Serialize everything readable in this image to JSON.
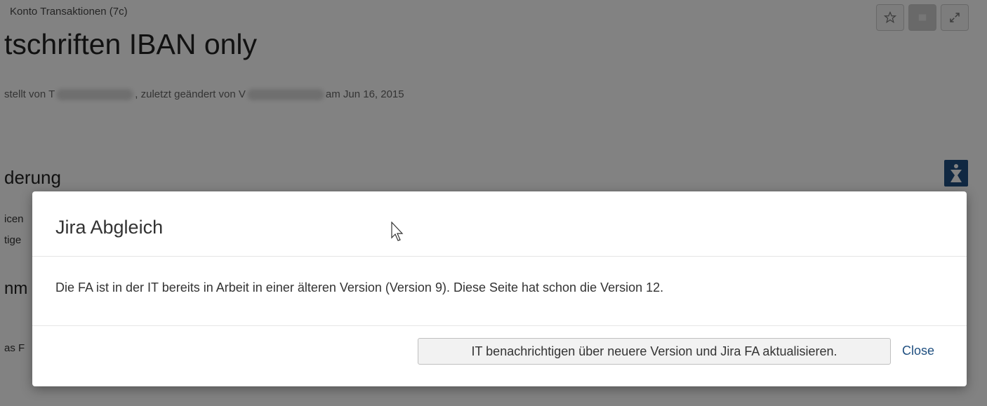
{
  "page": {
    "breadcrumb": "Konto Transaktionen (7c)",
    "title": "tschriften IBAN only",
    "byline_prefix": "stellt von T",
    "byline_middle": ", zuletzt geändert von V",
    "byline_suffix": "am Jun 16, 2015",
    "section_heading": "derung",
    "fragment_1": "icen",
    "fragment_2": "tige",
    "fragment_heading": "nm",
    "fragment_3": "as F"
  },
  "toolbar": {
    "icons": [
      "star-icon",
      "share-icon",
      "expand-icon"
    ]
  },
  "dialog": {
    "title": "Jira Abgleich",
    "message": "Die FA ist in der IT bereits in Arbeit in einer älteren Version (Version 9). Diese Seite hat schon die Version 12.",
    "primary_button_label": "IT benachrichtigen über neuere Version und Jira FA aktualisieren.",
    "close_label": "Close"
  },
  "colors": {
    "overlay": "rgba(0,0,0,0.49)",
    "link": "#205081",
    "logo": "#205081"
  }
}
